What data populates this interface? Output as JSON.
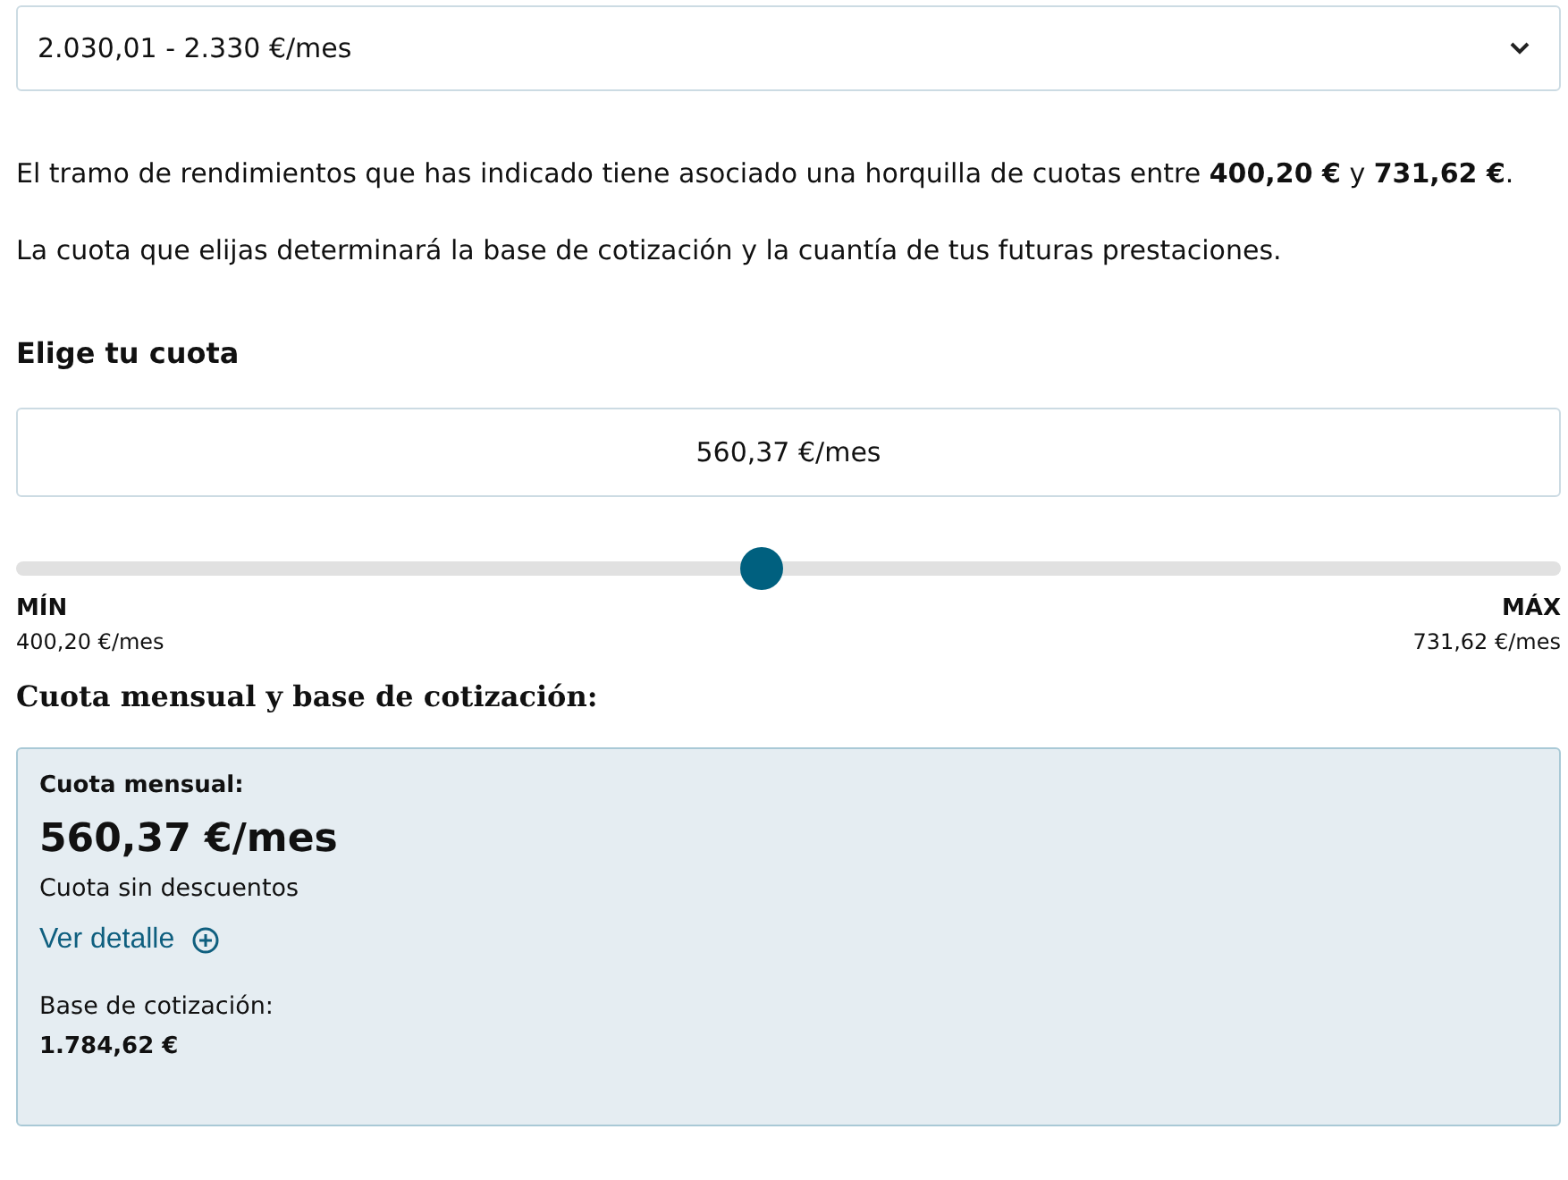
{
  "range_select": {
    "value": "2.030,01 - 2.330 €/mes"
  },
  "paragraphs": [
    "El tramo de rendimientos que has indicado tiene asociado una horquilla de cuotas entre **400,20 €** y **731,62 €**.",
    "La cuota que elijas determinará la base de cotización y la cuantía de tus futuras prestaciones."
  ],
  "choose_heading": "Elige tu cuota",
  "quota_field": {
    "value": "560,37 €/mes"
  },
  "slider": {
    "level": 0.483,
    "min_label": "MÍN",
    "min_value": "400,20 €/mes",
    "max_label": "MÁX",
    "max_value": "731,62 €/mes"
  },
  "summary_heading": "Cuota mensual y base de cotización:",
  "summary_card": {
    "title": "Cuota mensual:",
    "amount": "560,37 €/mes",
    "note": "Cuota sin descuentos",
    "detail_link": "Ver detalle",
    "base_label": "Base de cotización:",
    "base_value": "1.784,62 €"
  }
}
